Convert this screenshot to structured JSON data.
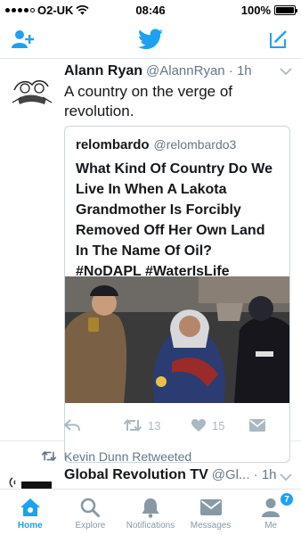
{
  "status_bar": {
    "carrier": "O2-UK",
    "time": "08:46",
    "battery": "100%",
    "battery_level": 1.0
  },
  "nav": {
    "left_icon": "add-user-icon",
    "center_icon": "twitter-bird-icon",
    "right_icon": "compose-icon"
  },
  "tweet1": {
    "display_name": "Alann Ryan",
    "handle": "@AlannRyan · 1h",
    "text": "A country on the verge of revolution.",
    "quote": {
      "display_name": "relombardo",
      "handle": "@relombardo3",
      "text": "What Kind Of Country Do We Live In When A Lakota Grandmother Is Forcibly Removed Off Her Own Land In The Name Of Oil? #NoDAPL #WaterIsLife"
    },
    "actions": {
      "retweets": "13",
      "likes": "15"
    }
  },
  "tweet2": {
    "retweeted_by": "Kevin Dunn Retweeted",
    "display_name": "Global Revolution TV",
    "handle": "@Gl... · 1h"
  },
  "tabs": [
    {
      "label": "Home",
      "active": true
    },
    {
      "label": "Explore"
    },
    {
      "label": "Notifications"
    },
    {
      "label": "Messages"
    },
    {
      "label": "Me",
      "badge": "7"
    }
  ],
  "colors": {
    "accent": "#1da1f2",
    "muted": "#657786",
    "icon_muted": "#aab8c2",
    "border": "#e1e8ed"
  }
}
